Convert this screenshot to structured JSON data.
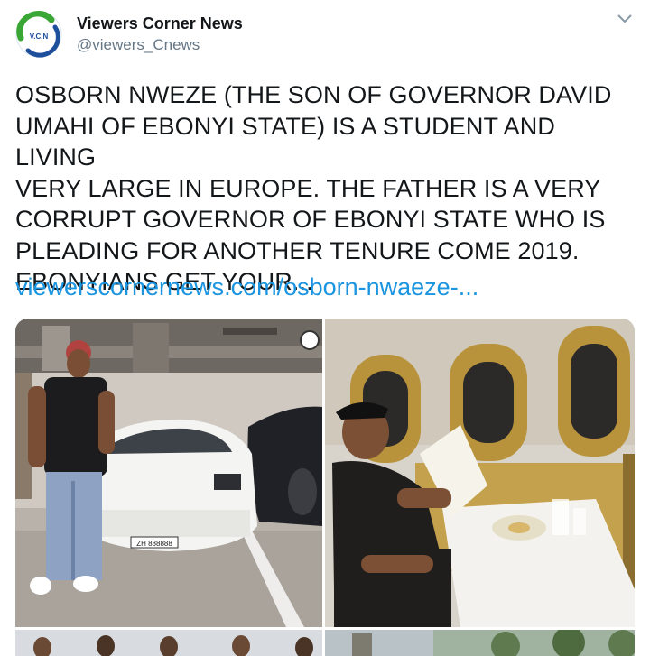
{
  "account": {
    "name": "Viewers Corner News",
    "handle": "@viewers_Cnews",
    "avatar_initials": "V.C.N"
  },
  "tweet": {
    "text": "OSBORN NWEZE (THE SON OF GOVERNOR DAVID\nUMAHI OF EBONYI STATE) IS A STUDENT AND LIVING\nVERY LARGE IN EUROPE. THE FATHER IS A VERY\nCORRUPT GOVERNOR OF EBONYI STATE WHO IS\nPLEADING FOR ANOTHER TENURE COME 2019.\nEBONYIANS GET YOUR...",
    "link_text": "viewerscornernews.com/osborn-nwaeze-..."
  },
  "media": {
    "photos": [
      {
        "id": "car-garage-photo",
        "plate_text": "ZH 888888"
      },
      {
        "id": "private-jet-photo"
      },
      {
        "id": "group-photo"
      },
      {
        "id": "outdoor-photo"
      }
    ]
  },
  "colors": {
    "link": "#1b95e0",
    "secondary_text": "#657786",
    "avatar_green": "#3aa635",
    "avatar_blue": "#1d4f9c"
  },
  "icons": {
    "menu": "chevron-down-icon"
  }
}
